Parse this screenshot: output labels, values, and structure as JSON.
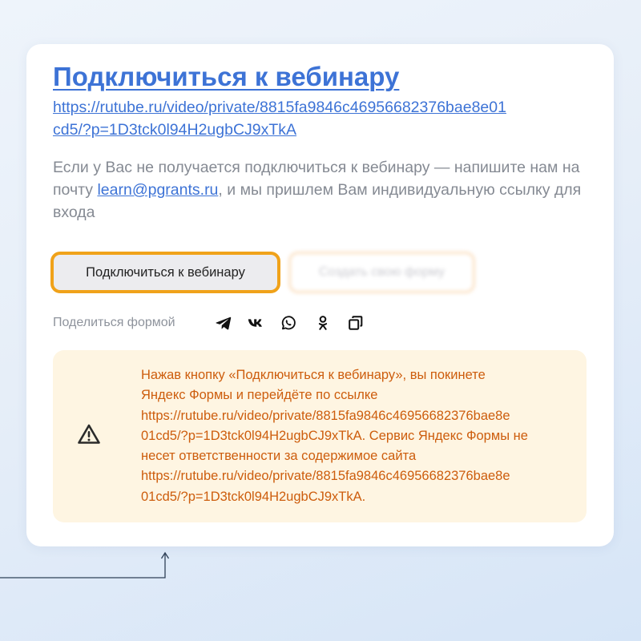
{
  "title": "Подключиться к вебинару",
  "link": {
    "line1": "https://rutube.ru/video/private/8815fa9846c46956682376bae8e01",
    "line2": "cd5/?p=1D3tck0l94H2ugbCJ9xTkA"
  },
  "description": {
    "before": "Если у Вас не получается подключиться к вебинару — напишите нам на почту ",
    "email": "learn@pgrants.ru",
    "after": ", и мы пришлем Вам индивидуальную ссылку для входа"
  },
  "buttons": {
    "primary_label": "Подключиться к вебинару",
    "secondary_label": "Создать свою форму"
  },
  "share": {
    "label": "Поделиться формой",
    "icons": [
      "telegram-icon",
      "vk-icon",
      "whatsapp-icon",
      "odnoklassniki-icon",
      "copy-icon"
    ]
  },
  "warning": {
    "line1": "Нажав кнопку «Подключиться к вебинару», вы покинете",
    "line2": "Яндекс Формы и перейдёте по ссылке",
    "line3": "https://rutube.ru/video/private/8815fa9846c46956682376bae8e",
    "line4": "01cd5/?p=1D3tck0l94H2ugbCJ9xTkA. Сервис Яндекс Формы не",
    "line5": "несет ответственности за содержимое сайта",
    "line6": "https://rutube.ru/video/private/8815fa9846c46956682376bae8e",
    "line7": "01cd5/?p=1D3tck0l94H2ugbCJ9xTkA."
  },
  "colors": {
    "link": "#3d73d6",
    "accent_border": "#f0a21a",
    "warning_bg": "#fef5e2",
    "warning_text": "#cd5d0d",
    "muted_text": "#858a93"
  }
}
